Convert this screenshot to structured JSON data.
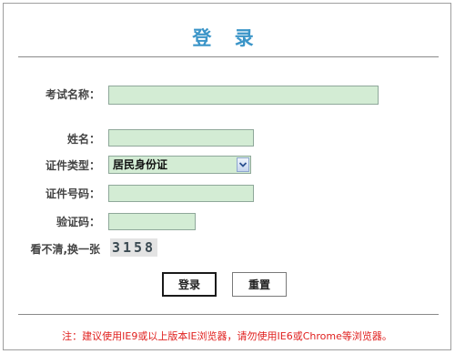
{
  "title": "登 录",
  "form": {
    "exam_name_label": "考试名称：",
    "exam_name_value": "",
    "name_label": "姓名：",
    "name_value": "",
    "id_type_label": "证件类型：",
    "id_type_value": "居民身份证",
    "id_number_label": "证件号码：",
    "id_number_value": "",
    "captcha_label": "验证码：",
    "captcha_value": "",
    "refresh_label": "看不清,换一张",
    "captcha_image_text": "3158"
  },
  "buttons": {
    "login": "登录",
    "reset": "重置"
  },
  "notice": "注：建议使用IE9或以上版本IE浏览器，请勿使用IE6或Chrome等浏览器。",
  "colors": {
    "title": "#3b95c8",
    "field_bg": "#d3ecd4",
    "notice": "#e0211f"
  },
  "icons": {
    "select_arrow": "chevron-down-icon"
  }
}
